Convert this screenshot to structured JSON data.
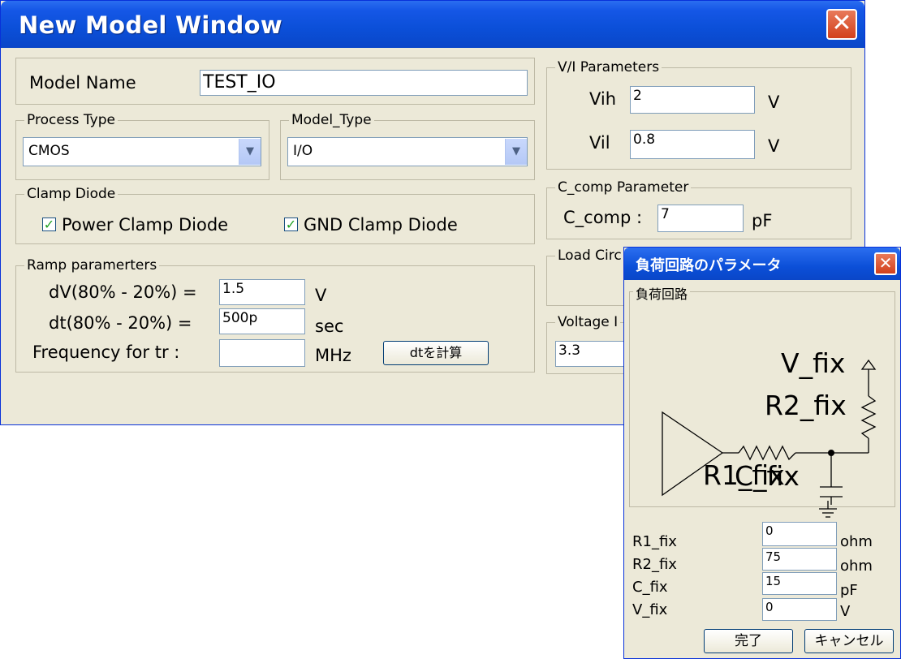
{
  "main_window": {
    "title": "New Model Window",
    "close_icon": "close-icon",
    "model_name": {
      "label": "Model Name",
      "value": "TEST_IO"
    },
    "process_type": {
      "legend": "Process Type",
      "selected": "CMOS"
    },
    "model_type": {
      "legend": "Model_Type",
      "selected": "I/O"
    },
    "clamp_diode": {
      "legend": "Clamp Diode",
      "power": {
        "label": "Power Clamp Diode",
        "checked": true
      },
      "gnd": {
        "label": "GND Clamp Diode",
        "checked": true
      }
    },
    "ramp": {
      "legend": "Ramp paramerters",
      "dv_label": "dV(80% - 20%) =",
      "dv_value": "1.5",
      "dv_unit": "V",
      "dt_label": "dt(80% - 20%) =",
      "dt_value": "500p",
      "dt_unit": "sec",
      "freq_label": "Frequency for tr :",
      "freq_value": "",
      "freq_unit": "MHz",
      "calc_button": "dtを計算"
    },
    "vi": {
      "legend": "V/I Parameters",
      "vih_label": "Vih",
      "vih_value": "2",
      "vih_unit": "V",
      "vil_label": "Vil",
      "vil_value": "0.8",
      "vil_unit": "V"
    },
    "ccomp": {
      "legend": "C_comp Parameter",
      "label": "C_comp :",
      "value": "7",
      "unit": "pF"
    },
    "load_circuit": {
      "legend": "Load Circ"
    },
    "voltage": {
      "legend": "Voltage I",
      "value": "3.3"
    }
  },
  "dialog": {
    "title": "負荷回路のパラメータ",
    "group_legend": "負荷回路",
    "circuit": {
      "v_fix": "V_fix",
      "r2_fix": "R2_fix",
      "r1_fix": "R1_fix",
      "c_fix": "C_fix"
    },
    "params": [
      {
        "label": "R1_fix",
        "value": "0",
        "unit": "ohm"
      },
      {
        "label": "R2_fix",
        "value": "75",
        "unit": "ohm"
      },
      {
        "label": "C_fix",
        "value": "15",
        "unit": "pF"
      },
      {
        "label": "V_fix",
        "value": "0",
        "unit": "V"
      }
    ],
    "ok_button": "完了",
    "cancel_button": "キャンセル"
  },
  "colors": {
    "titlebar": "#0b4fd8",
    "window_bg": "#ece9d8",
    "close": "#d2401c",
    "check": "#21a121"
  }
}
